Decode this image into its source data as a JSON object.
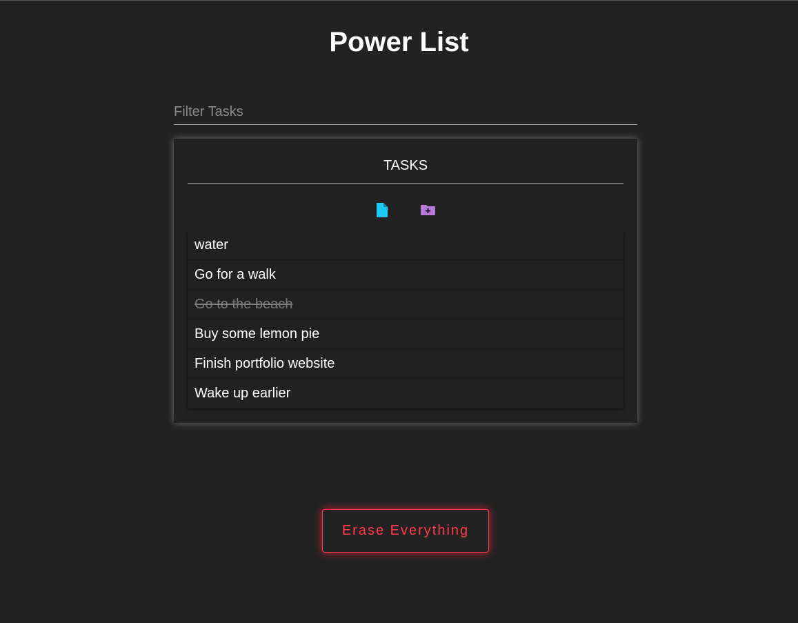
{
  "app": {
    "title": "Power List"
  },
  "filter": {
    "placeholder": "Filter Tasks",
    "value": ""
  },
  "tasks_panel": {
    "heading": "TASKS",
    "icons": [
      {
        "name": "file-icon",
        "color": "#1ec8f5"
      },
      {
        "name": "folder-plus-icon",
        "color": "#b57ad6"
      }
    ],
    "items": [
      {
        "label": "water",
        "done": false
      },
      {
        "label": "Go for a walk",
        "done": false
      },
      {
        "label": "Go to the beach",
        "done": true
      },
      {
        "label": "Buy some lemon pie",
        "done": false
      },
      {
        "label": "Finish portfolio website",
        "done": false
      },
      {
        "label": "Wake up earlier",
        "done": false
      }
    ]
  },
  "erase_button": {
    "label": "Erase Everything",
    "color": "#ff3b4b"
  }
}
